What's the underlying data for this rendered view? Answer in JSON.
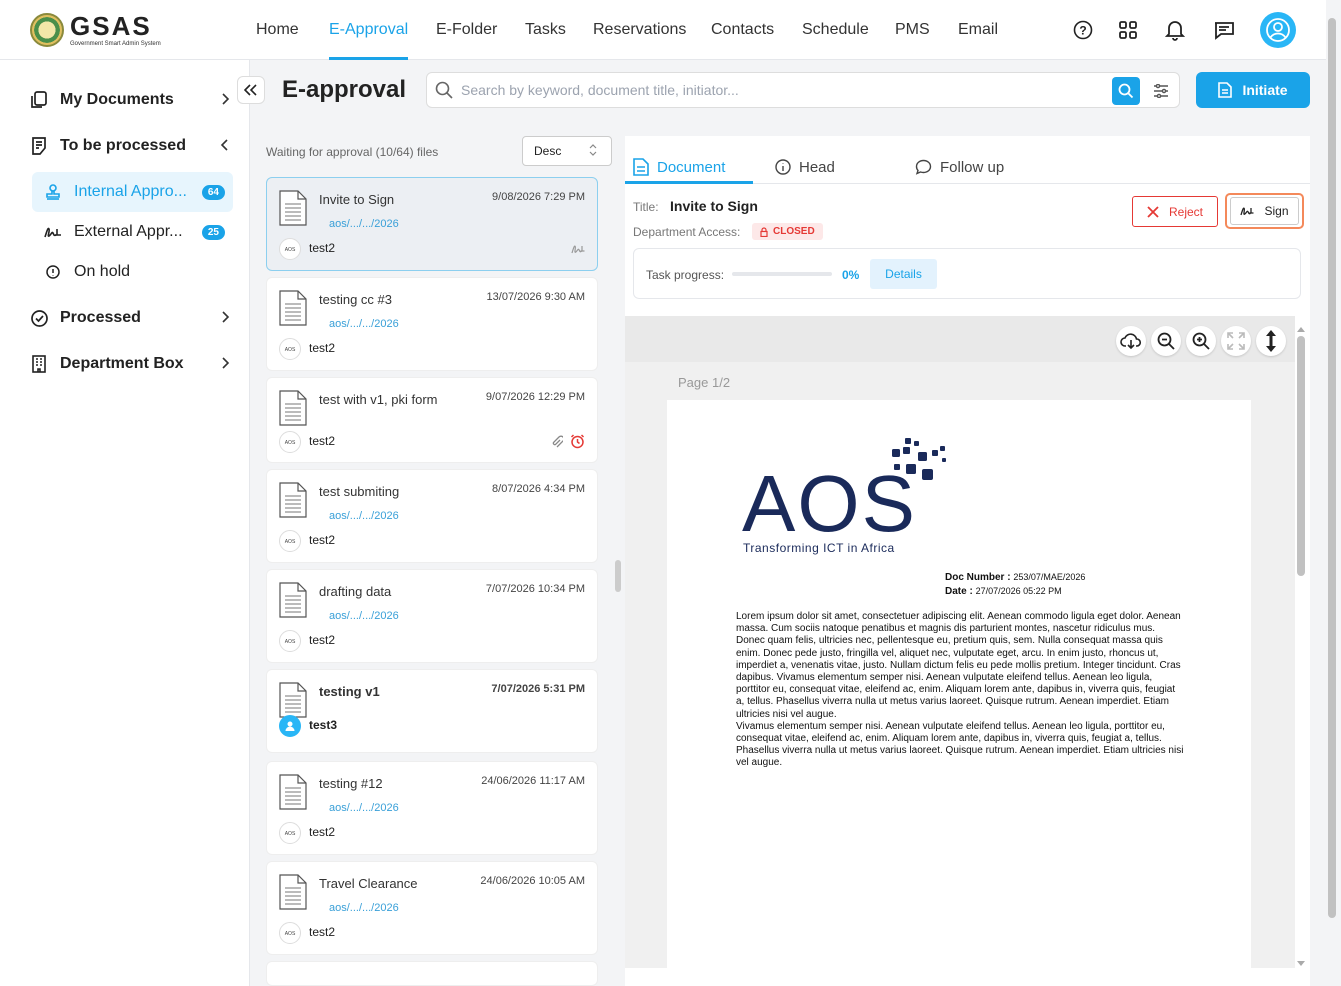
{
  "brand": {
    "name": "GSAS",
    "subtitle": "Government Smart Admin System"
  },
  "nav": {
    "items": [
      "Home",
      "E-Approval",
      "E-Folder",
      "Tasks",
      "Reservations",
      "Contacts",
      "Schedule",
      "PMS",
      "Email"
    ],
    "active": "E-Approval"
  },
  "top_icons": [
    "help-icon",
    "apps-grid-icon",
    "bell-icon",
    "chat-icon",
    "user-avatar"
  ],
  "sidebar": {
    "items": [
      {
        "label": "My Documents",
        "icon": "documents-icon",
        "chevron": ">"
      },
      {
        "label": "To be processed",
        "icon": "clipboard-icon",
        "chevron": "<"
      },
      {
        "label": "Processed",
        "icon": "check-circle-icon",
        "chevron": ">"
      },
      {
        "label": "Department Box",
        "icon": "building-icon",
        "chevron": ">"
      }
    ],
    "sub_items": [
      {
        "label": "Internal Appro...",
        "badge": "64",
        "icon": "stamp-icon",
        "active": true
      },
      {
        "label": "External Appr...",
        "badge": "25",
        "icon": "signature-icon"
      },
      {
        "label": "On hold",
        "icon": "info-circle-icon"
      }
    ]
  },
  "header": {
    "title": "E-approval",
    "search_placeholder": "Search by keyword, document title, initiator...",
    "initiate_label": "Initiate"
  },
  "list": {
    "waiting_text": "Waiting for approval (10/64) files",
    "sort_value": "Desc",
    "cards": [
      {
        "title": "Invite to Sign",
        "date": "9/08/2026 7:29 PM",
        "path": "aos/.../.../2026",
        "user": "test2",
        "selected": true,
        "right_icons": [
          "signature-icon"
        ]
      },
      {
        "title": "testing cc #3",
        "date": "13/07/2026 9:30 AM",
        "path": "aos/.../.../2026",
        "user": "test2"
      },
      {
        "title": "test with v1, pki form",
        "date": "9/07/2026 12:29 PM",
        "path": "",
        "user": "test2",
        "right_icons": [
          "paperclip-icon",
          "alarm-icon"
        ]
      },
      {
        "title": "test submiting",
        "date": "8/07/2026 4:34 PM",
        "path": "aos/.../.../2026",
        "user": "test2"
      },
      {
        "title": "drafting data",
        "date": "7/07/2026 10:34 PM",
        "path": "aos/.../.../2026",
        "user": "test2"
      },
      {
        "title": "testing v1",
        "date": "7/07/2026 5:31 PM",
        "path": "",
        "user": "test3",
        "bold": true
      },
      {
        "title": "testing #12",
        "date": "24/06/2026 11:17 AM",
        "path": "aos/.../.../2026",
        "user": "test2"
      },
      {
        "title": "Travel Clearance",
        "date": "24/06/2026 10:05 AM",
        "path": "aos/.../.../2026",
        "user": "test2"
      }
    ]
  },
  "detail": {
    "tabs": [
      "Document",
      "Head",
      "Follow up"
    ],
    "active_tab": "Document",
    "title_label": "Title:",
    "title_value": "Invite to Sign",
    "dept_label": "Department Access:",
    "dept_badge": "CLOSED",
    "reject_label": "Reject",
    "sign_label": "Sign",
    "progress_label": "Task progress:",
    "progress_value": 0,
    "progress_pct": "0%",
    "details_label": "Details"
  },
  "viewer": {
    "page_label": "Page 1/2",
    "toolbar": [
      "cloud-download-icon",
      "zoom-out-icon",
      "zoom-in-icon",
      "fullscreen-icon",
      "fit-height-icon"
    ],
    "logo_text": "AOS",
    "logo_tagline": "Transforming ICT in Africa",
    "doc_number_label": "Doc  Number  :",
    "doc_number": "253/07/MAE/2026",
    "date_label": "Date  :",
    "date": "27/07/2026 05:22 PM",
    "body": "Lorem ipsum dolor sit amet, consectetuer adipiscing elit. Aenean commodo ligula eget dolor. Aenean massa. Cum sociis natoque penatibus et magnis dis parturient montes, nascetur ridiculus mus. Donec quam felis, ultricies nec, pellentesque eu, pretium quis, sem. Nulla consequat massa quis enim. Donec pede justo, fringilla vel, aliquet nec, vulputate eget, arcu. In enim justo, rhoncus ut, imperdiet a, venenatis vitae, justo. Nullam dictum felis eu pede mollis pretium. Integer tincidunt. Cras dapibus. Vivamus elementum semper nisi. Aenean vulputate eleifend tellus. Aenean leo ligula, porttitor eu, consequat vitae, eleifend ac, enim. Aliquam lorem ante, dapibus in, viverra quis, feugiat a, tellus. Phasellus viverra nulla ut metus varius laoreet. Quisque rutrum. Aenean imperdiet. Etiam ultricies nisi vel augue.",
    "body2": "Vivamus elementum semper nisi. Aenean vulputate eleifend tellus. Aenean leo ligula, porttitor eu, consequat vitae, eleifend ac, enim. Aliquam lorem ante, dapibus in, viverra quis, feugiat a, tellus. Phasellus viverra nulla ut metus varius laoreet. Quisque rutrum. Aenean imperdiet. Etiam ultricies nisi vel augue."
  },
  "colors": {
    "accent": "#1aa3e8",
    "danger": "#e53935",
    "highlight": "#f4895a"
  }
}
